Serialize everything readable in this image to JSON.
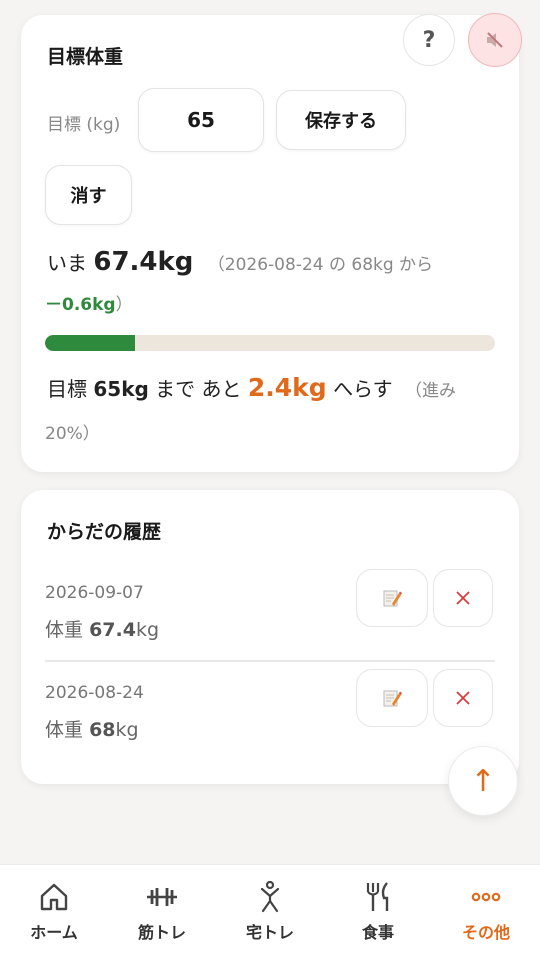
{
  "goal": {
    "title": "目標体重",
    "input_label": "目標 (kg)",
    "input_value": "65",
    "save_label": "保存する",
    "clear_label": "消す",
    "current_prefix": "いま",
    "current_weight": "67.4kg",
    "compare_text": "（2026-08-24 の 68kg から",
    "delta": "－0.6kg",
    "compare_close": "）",
    "progress_percent": 20,
    "remaining_prefix": "目標",
    "remaining_target": "65kg",
    "remaining_mid": "まで あと",
    "remaining_amount": "2.4kg",
    "remaining_suffix": "へらす",
    "progress_text_1": "（進み",
    "progress_text_2": "20%）",
    "help_label": "?"
  },
  "history": {
    "title": "からだの履歴",
    "rows": [
      {
        "date": "2026-09-07",
        "label": "体重",
        "value": "67.4",
        "unit": "kg"
      },
      {
        "date": "2026-08-24",
        "label": "体重",
        "value": "68",
        "unit": "kg"
      }
    ]
  },
  "scroll_top_label": "↑",
  "tabs": [
    {
      "label": "ホーム",
      "icon": "home-icon"
    },
    {
      "label": "筋トレ",
      "icon": "dumbbell-icon"
    },
    {
      "label": "宅トレ",
      "icon": "person-exercise-icon"
    },
    {
      "label": "食事",
      "icon": "fork-knife-icon"
    },
    {
      "label": "その他",
      "icon": "more-dots-icon",
      "active": true
    }
  ],
  "colors": {
    "accent": "#e06a1b",
    "progress": "#2e8b3e",
    "mute_button_bg": "#fde3e3",
    "delete_red": "#d93b3b"
  }
}
